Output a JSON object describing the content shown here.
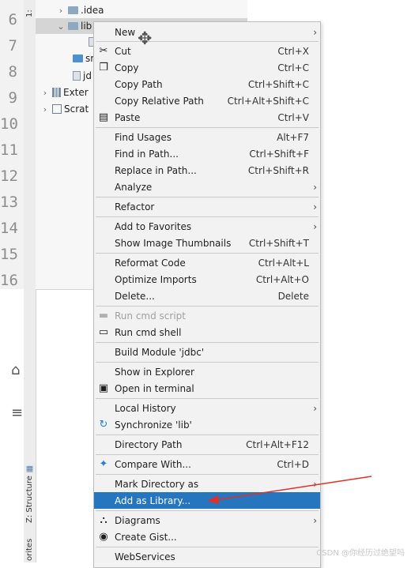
{
  "gutter": {
    "line_numbers": [
      "6",
      "7",
      "8",
      "9",
      "10",
      "11",
      "12",
      "13",
      "14",
      "15",
      "16"
    ]
  },
  "sidebar": {
    "structure_label": "Z: Structure",
    "favorites_label": "orites",
    "top_label": "1:"
  },
  "tree": {
    "idea": ".idea",
    "lib": "lib",
    "src": "sr",
    "iml": "jd",
    "external": "Exter",
    "scratches": "Scrat"
  },
  "menu": {
    "new": {
      "label": "New"
    },
    "cut": {
      "label": "Cut",
      "shortcut": "Ctrl+X"
    },
    "copy": {
      "label": "Copy",
      "shortcut": "Ctrl+C"
    },
    "copy_path": {
      "label": "Copy Path",
      "shortcut": "Ctrl+Shift+C"
    },
    "copy_relative_path": {
      "label": "Copy Relative Path",
      "shortcut": "Ctrl+Alt+Shift+C"
    },
    "paste": {
      "label": "Paste",
      "shortcut": "Ctrl+V"
    },
    "find_usages": {
      "label": "Find Usages",
      "shortcut": "Alt+F7"
    },
    "find_in_path": {
      "label": "Find in Path...",
      "shortcut": "Ctrl+Shift+F"
    },
    "replace_in_path": {
      "label": "Replace in Path...",
      "shortcut": "Ctrl+Shift+R"
    },
    "analyze": {
      "label": "Analyze"
    },
    "refactor": {
      "label": "Refactor"
    },
    "add_to_favorites": {
      "label": "Add to Favorites"
    },
    "show_image_thumbnails": {
      "label": "Show Image Thumbnails",
      "shortcut": "Ctrl+Shift+T"
    },
    "reformat_code": {
      "label": "Reformat Code",
      "shortcut": "Ctrl+Alt+L"
    },
    "optimize_imports": {
      "label": "Optimize Imports",
      "shortcut": "Ctrl+Alt+O"
    },
    "delete": {
      "label": "Delete...",
      "shortcut": "Delete"
    },
    "run_cmd_script": {
      "label": "Run cmd script"
    },
    "run_cmd_shell": {
      "label": "Run cmd shell"
    },
    "build_module": {
      "label": "Build Module 'jdbc'"
    },
    "show_in_explorer": {
      "label": "Show in Explorer"
    },
    "open_in_terminal": {
      "label": "Open in terminal"
    },
    "local_history": {
      "label": "Local History"
    },
    "synchronize": {
      "label": "Synchronize 'lib'"
    },
    "directory_path": {
      "label": "Directory Path",
      "shortcut": "Ctrl+Alt+F12"
    },
    "compare_with": {
      "label": "Compare With...",
      "shortcut": "Ctrl+D"
    },
    "mark_directory_as": {
      "label": "Mark Directory as"
    },
    "add_as_library": {
      "label": "Add as Library..."
    },
    "diagrams": {
      "label": "Diagrams"
    },
    "create_gist": {
      "label": "Create Gist..."
    },
    "webservices": {
      "label": "WebServices"
    }
  },
  "colors": {
    "highlight": "#2675bf",
    "arrow": "#e0302a",
    "menu_bg": "#f2f2f2"
  },
  "watermark": "CSDN @你经历过绝望吗"
}
